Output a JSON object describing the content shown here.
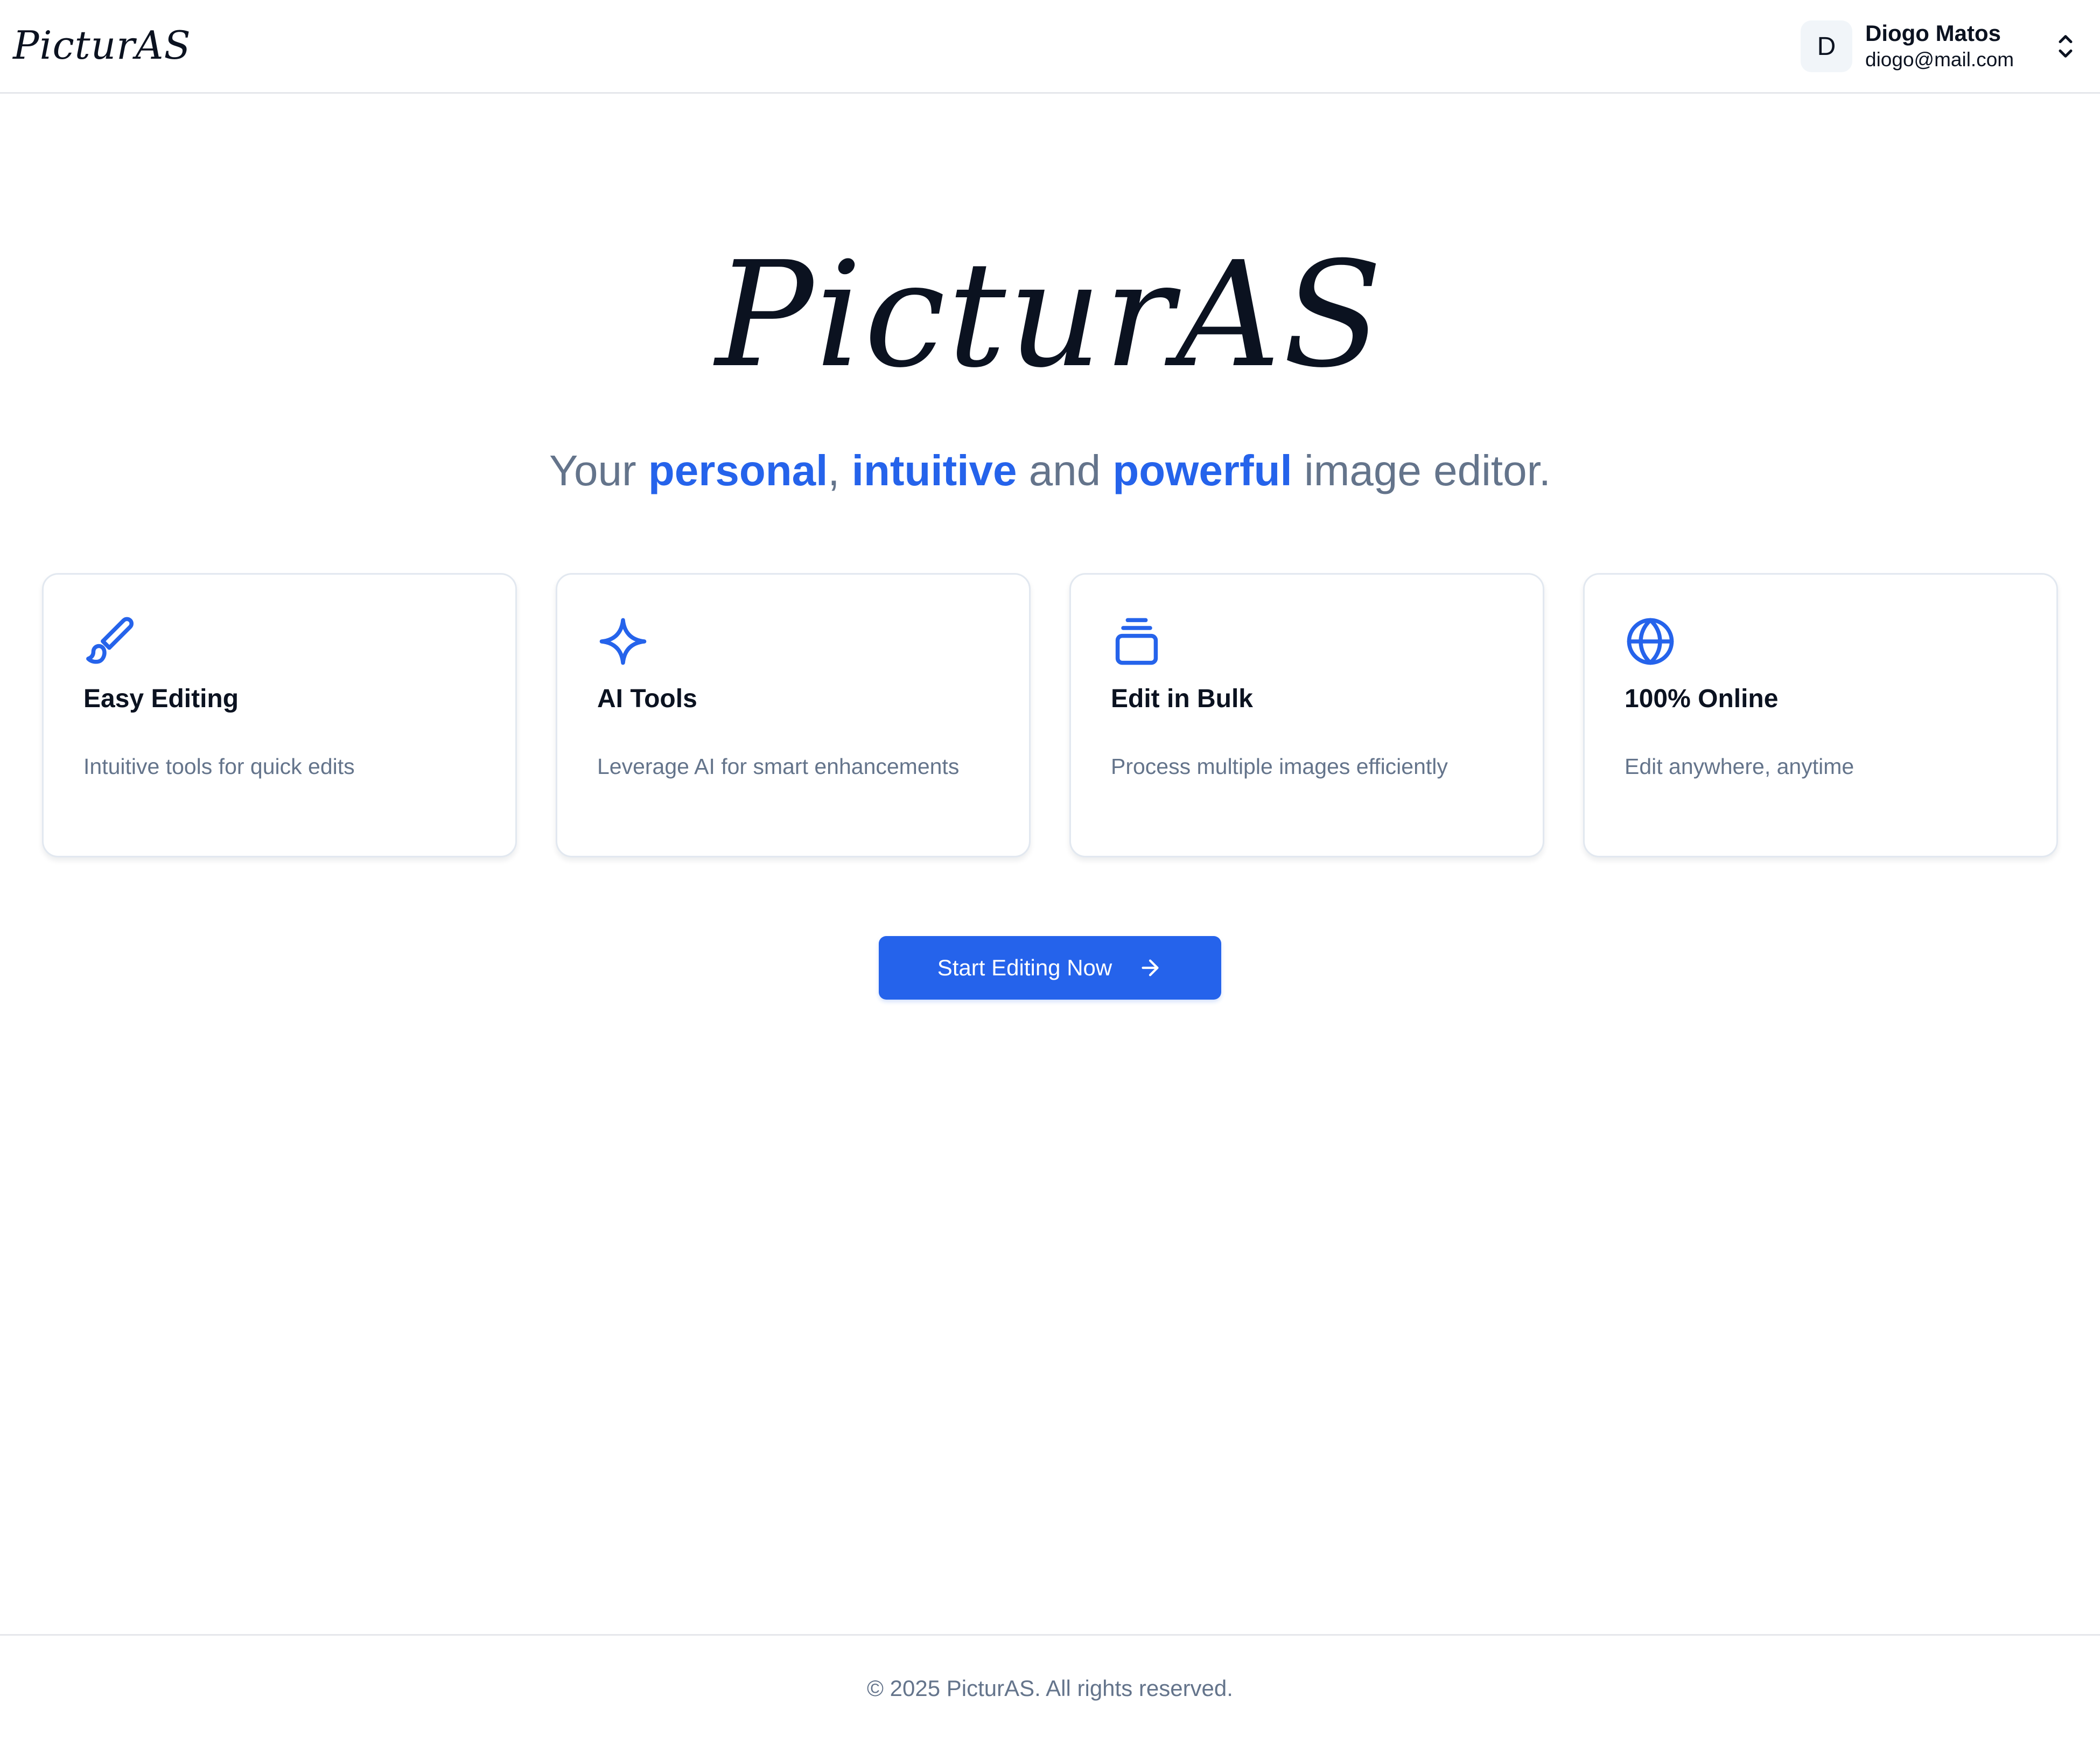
{
  "header": {
    "logo": "PicturAS",
    "user": {
      "avatar_initial": "D",
      "name": "Diogo Matos",
      "email": "diogo@mail.com"
    }
  },
  "hero": {
    "logo": "PicturAS",
    "tagline": {
      "prefix": "Your",
      "word1": "personal",
      "sep1": ",",
      "word2": "intuitive",
      "sep2": "and",
      "word3": "powerful",
      "suffix": "image editor."
    }
  },
  "features": [
    {
      "icon": "paintbrush-icon",
      "title": "Easy Editing",
      "description": "Intuitive tools for quick edits"
    },
    {
      "icon": "sparkle-icon",
      "title": "AI Tools",
      "description": "Leverage AI for smart enhancements"
    },
    {
      "icon": "stack-icon",
      "title": "Edit in Bulk",
      "description": "Process multiple images efficiently"
    },
    {
      "icon": "globe-icon",
      "title": "100% Online",
      "description": "Edit anywhere, anytime"
    }
  ],
  "cta": {
    "label": "Start Editing Now",
    "icon": "arrow-right-icon"
  },
  "footer": {
    "copyright": "© 2025 PicturAS. All rights reserved."
  },
  "colors": {
    "accent": "#2563eb",
    "muted_text": "#64748b",
    "text": "#0b1220",
    "border": "#e2e8f0"
  }
}
